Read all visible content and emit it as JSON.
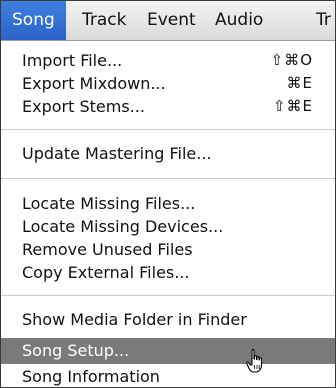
{
  "menubar": {
    "items": [
      "Song",
      "Track",
      "Event",
      "Audio",
      "Tr"
    ]
  },
  "menu": {
    "import_file": {
      "label": "Import File...",
      "shortcut": "⇧⌘O"
    },
    "export_mixdown": {
      "label": "Export Mixdown...",
      "shortcut": "⌘E"
    },
    "export_stems": {
      "label": "Export Stems...",
      "shortcut": "⇧⌘E"
    },
    "update_mastering": {
      "label": "Update Mastering File..."
    },
    "locate_missing_files": {
      "label": "Locate Missing Files..."
    },
    "locate_missing_devices": {
      "label": "Locate Missing Devices..."
    },
    "remove_unused_files": {
      "label": "Remove Unused Files"
    },
    "copy_external_files": {
      "label": "Copy External Files..."
    },
    "show_media_folder": {
      "label": "Show Media Folder in Finder"
    },
    "song_setup": {
      "label": "Song Setup..."
    },
    "song_information": {
      "label": "Song Information"
    }
  },
  "icons": {
    "cursor": "hand-pointer-icon"
  },
  "colors": {
    "menu_title_highlight": "#2f6fd6",
    "item_highlight": "#7a7a7a"
  }
}
